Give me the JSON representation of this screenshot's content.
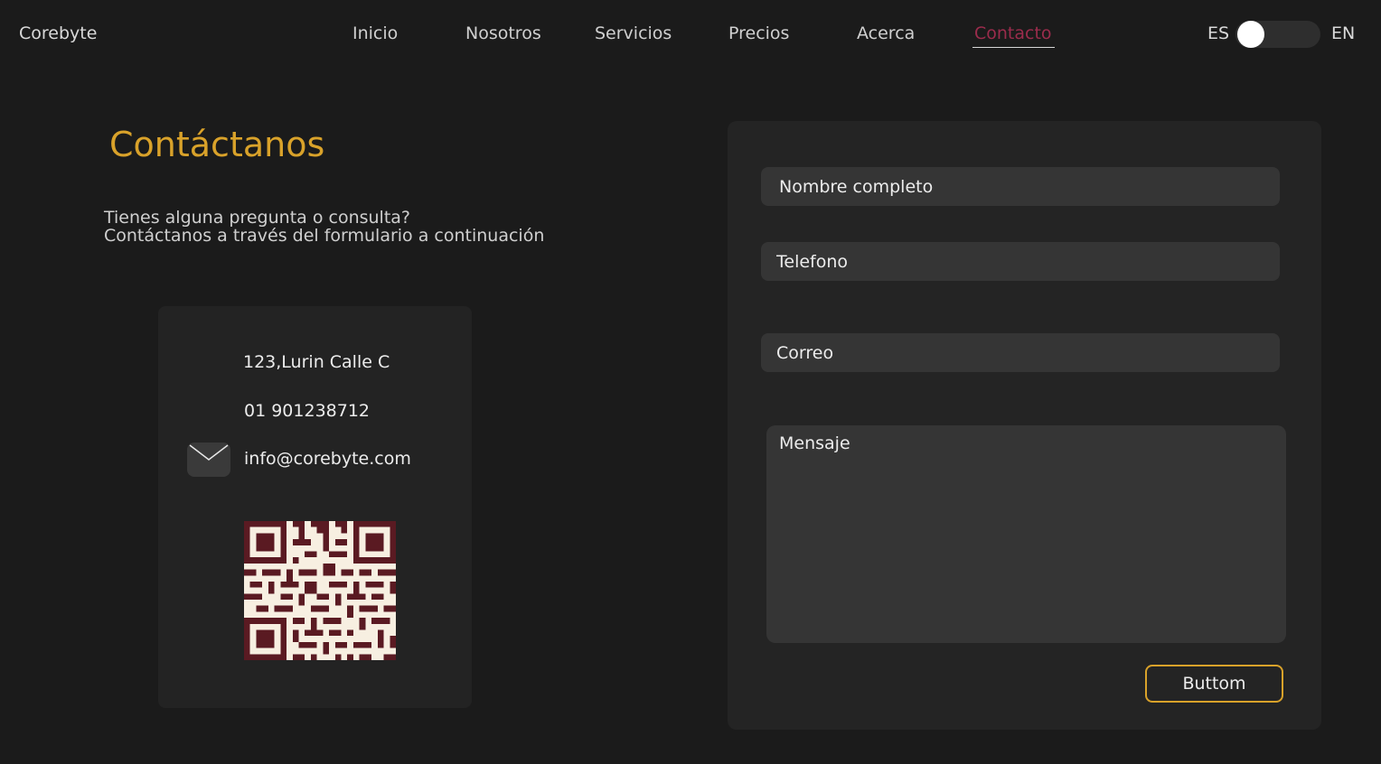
{
  "header": {
    "brand": "Corebyte",
    "nav": [
      {
        "label": "Inicio"
      },
      {
        "label": "Nosotros"
      },
      {
        "label": "Servicios"
      },
      {
        "label": "Precios"
      },
      {
        "label": "Acerca"
      },
      {
        "label": "Contacto",
        "active": true
      }
    ],
    "lang_left": "ES",
    "lang_right": "EN"
  },
  "contact": {
    "title": "Contáctanos",
    "intro_line1": "Tienes alguna pregunta o consulta?",
    "intro_line2": "Contáctanos a través del formulario a continuación",
    "address": "123,Lurin Calle C",
    "phone": "01 901238712",
    "email": "info@corebyte.com"
  },
  "form": {
    "name_placeholder": "Nombre completo",
    "phone_placeholder": "Telefono",
    "email_placeholder": "Correo",
    "message_placeholder": "Mensaje",
    "submit_label": "Buttom"
  },
  "colors": {
    "accent": "#d9a22a",
    "active_nav": "#9b2c4c",
    "qr_dark": "#5a1a22",
    "qr_light": "#f7efe1"
  },
  "icons": {
    "mail": "envelope-icon",
    "qr": "qr-code"
  }
}
